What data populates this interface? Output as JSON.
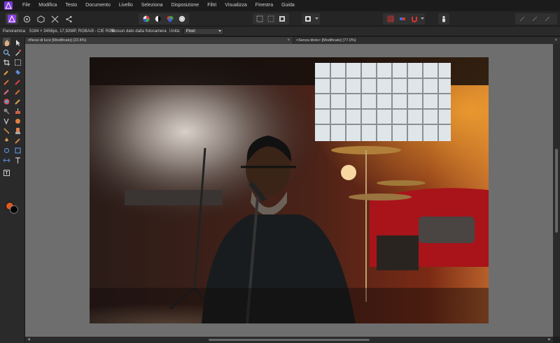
{
  "menu": {
    "items": [
      "File",
      "Modifica",
      "Testo",
      "Documento",
      "Livello",
      "Seleziona",
      "Disposizione",
      "Filtri",
      "Visualizza",
      "Finestra",
      "Guida"
    ]
  },
  "context_bar": {
    "tool_name": "Panoramica",
    "image_info": "5184 × 3456px, 17,92MP, RGBA/8 - CIE RGB",
    "camera_info": "Nessun dato dalla fotocamera",
    "unit_label": "Unità:",
    "unit_value": "Pixel"
  },
  "tabs": [
    {
      "label": "riflessi di luce [Modificato] (22.8%)",
      "close": "×"
    },
    {
      "label": "<Senza titolo> [Modificato] (77.0%)",
      "close": "×"
    }
  ],
  "colors": {
    "foreground": "#e2591f",
    "background": "#000000",
    "brand": "#7a3bd6"
  },
  "icons": {
    "persona_photo": "photo-persona-icon",
    "persona_liquify": "liquify-persona-icon",
    "persona_develop": "develop-persona-icon",
    "persona_tonemap": "tone-mapping-persona-icon",
    "persona_export": "export-persona-icon"
  }
}
